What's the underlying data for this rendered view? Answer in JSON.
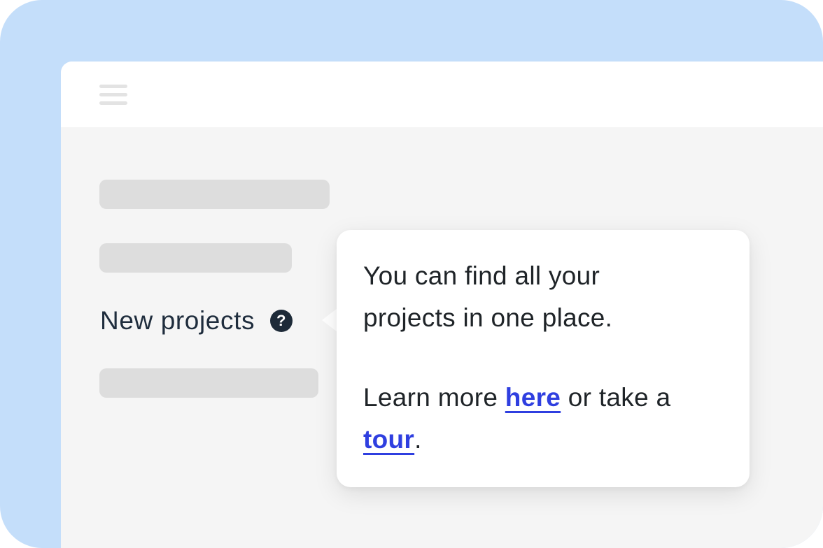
{
  "nav": {
    "item_label": "New projects"
  },
  "help_icon": {
    "glyph": "?"
  },
  "tooltip": {
    "line1": "You can find all your",
    "line2": "projects in one place.",
    "learn_prefix": "Learn more ",
    "here_link": "here",
    "middle": " or take a",
    "tour_link": "tour",
    "suffix": "."
  },
  "colors": {
    "frame_bg": "#c4defa",
    "window_bg": "#f5f5f5",
    "placeholder": "#dddddd",
    "link": "#2f3fe0",
    "text": "#1f2428"
  },
  "icons": [
    "hamburger-menu-icon",
    "help-icon"
  ]
}
